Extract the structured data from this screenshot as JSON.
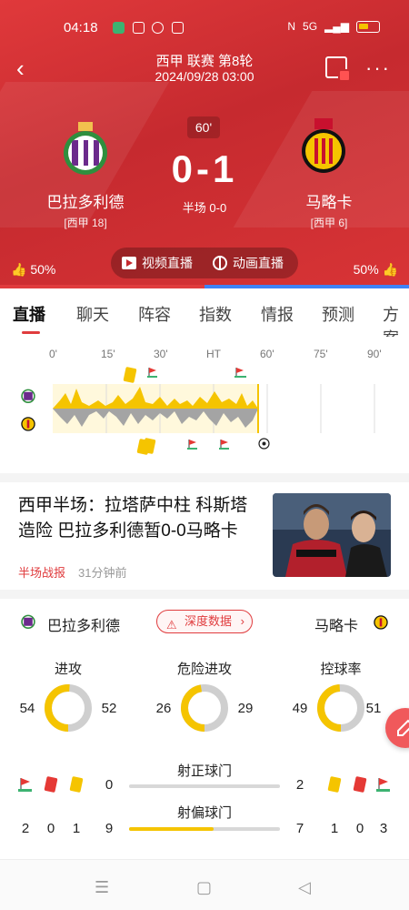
{
  "status_bar": {
    "time": "04:18",
    "network_label": "5G"
  },
  "header": {
    "league": "西甲 联赛 第8轮",
    "datetime": "2024/09/28 03:00",
    "minute": "60'",
    "score": "0-1",
    "halftime": "半场 0-0",
    "home": {
      "name": "巴拉多利德",
      "rank": "[西甲 18]"
    },
    "away": {
      "name": "马略卡",
      "rank": "[西甲 6]"
    },
    "video_live": "视频直播",
    "anim_live": "动画直播",
    "home_vote": "50%",
    "away_vote": "50%",
    "vote_home_fraction": 0.5,
    "colors": {
      "accent": "#e03c3e",
      "away_bar": "#3e82f7",
      "gold": "#f5c400"
    }
  },
  "tabs": [
    "直播",
    "聊天",
    "阵容",
    "指数",
    "情报",
    "预测",
    "方案"
  ],
  "timeline": {
    "axis": [
      "0'",
      "15'",
      "30'",
      "HT",
      "60'",
      "75'",
      "90'"
    ]
  },
  "news": {
    "title": "西甲半场：拉塔萨中柱 科斯塔造险 巴拉多利德暂0-0马略卡",
    "tag": "半场战报",
    "time": "31分钟前"
  },
  "stats": {
    "home_team": "巴拉多利德",
    "away_team": "马略卡",
    "deep_data": "深度数据",
    "rings": [
      {
        "label": "进攻",
        "home": "54",
        "away": "52",
        "home_value": 54,
        "away_value": 52
      },
      {
        "label": "危险进攻",
        "home": "26",
        "away": "29",
        "home_value": 26,
        "away_value": 29
      },
      {
        "label": "控球率",
        "home": "49",
        "away": "51",
        "home_value": 49,
        "away_value": 51
      }
    ],
    "on_target": {
      "label": "射正球门",
      "home": "0",
      "away": "2",
      "home_fraction": 0.0
    },
    "off_target": {
      "label": "射偏球门",
      "home": "9",
      "away": "7",
      "home_fraction": 0.56
    },
    "home_counts": {
      "corners": "2",
      "red": "0",
      "yellow": "1"
    },
    "away_counts": {
      "yellow": "1",
      "red": "0",
      "corners": "3"
    }
  }
}
